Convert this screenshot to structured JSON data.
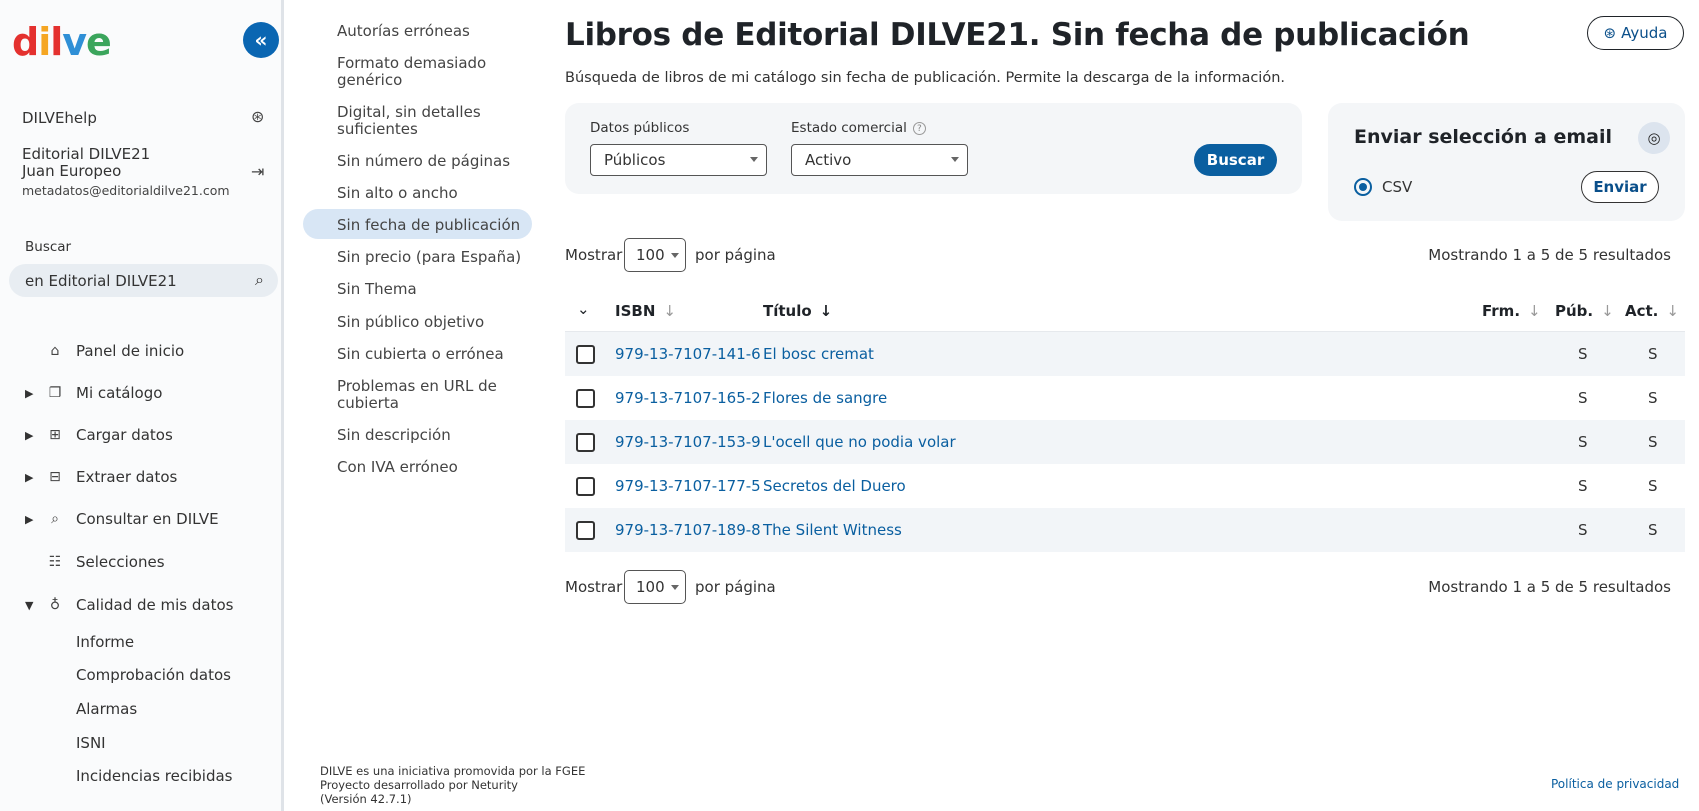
{
  "sidebar": {
    "logo": {
      "l1": "d",
      "l2": "i",
      "l3": "l",
      "l4": "v",
      "l5": "e"
    },
    "collapse_icon": "«",
    "help_label": "DILVEhelp",
    "user": {
      "company": "Editorial DILVE21",
      "name": "Juan Europeo",
      "email": "metadatos@editorialdilve21.com"
    },
    "search": {
      "label": "Buscar",
      "value": "en Editorial DILVE21"
    },
    "nav": [
      {
        "label": "Panel de inicio"
      },
      {
        "label": "Mi catálogo"
      },
      {
        "label": "Cargar datos"
      },
      {
        "label": "Extraer datos"
      },
      {
        "label": "Consultar en DILVE"
      },
      {
        "label": "Selecciones"
      },
      {
        "label": "Calidad de mis datos"
      }
    ],
    "sub": [
      {
        "label": "Informe"
      },
      {
        "label": "Comprobación datos"
      },
      {
        "label": "Alarmas"
      },
      {
        "label": "ISNI"
      },
      {
        "label": "Incidencias recibidas"
      }
    ]
  },
  "checks": [
    "Autorías erróneas",
    "Formato demasiado genérico",
    "Digital, sin detalles suficientes",
    "Sin número de páginas",
    "Sin alto o ancho",
    "Sin fecha de publicación",
    "Sin precio (para España)",
    "Sin Thema",
    "Sin público objetivo",
    "Sin cubierta o errónea",
    "Problemas en URL de cubierta",
    "Sin descripción",
    "Con IVA erróneo"
  ],
  "main": {
    "title": "Libros de Editorial DILVE21. Sin fecha de publicación",
    "description": "Búsqueda de libros de mi catálogo sin fecha de publicación. Permite la descarga de la información.",
    "help_button": "Ayuda",
    "filters": {
      "public_label": "Datos públicos",
      "public_value": "Públicos",
      "status_label": "Estado comercial",
      "status_value": "Activo",
      "search_button": "Buscar"
    },
    "email": {
      "title": "Enviar selección a email",
      "format": "CSV",
      "send_button": "Enviar"
    },
    "pager": {
      "show": "Mostrar",
      "per_page_value": "100",
      "per_page": "por página",
      "results": "Mostrando 1 a 5 de 5 resultados"
    },
    "table": {
      "headers": {
        "isbn": "ISBN",
        "title": "Título",
        "frm": "Frm.",
        "pub": "Púb.",
        "act": "Act."
      },
      "rows": [
        {
          "isbn": "979-13-7107-141-6",
          "title": "El bosc cremat",
          "pub": "S",
          "act": "S"
        },
        {
          "isbn": "979-13-7107-165-2",
          "title": "Flores de sangre",
          "pub": "S",
          "act": "S"
        },
        {
          "isbn": "979-13-7107-153-9",
          "title": "L'ocell que no podia volar",
          "pub": "S",
          "act": "S"
        },
        {
          "isbn": "979-13-7107-177-5",
          "title": "Secretos del Duero",
          "pub": "S",
          "act": "S"
        },
        {
          "isbn": "979-13-7107-189-8",
          "title": "The Silent Witness",
          "pub": "S",
          "act": "S"
        }
      ]
    }
  },
  "footer": {
    "line1": "DILVE es una iniciativa promovida por la FGEE",
    "line2": "Proyecto desarrollado por Neturity",
    "line3": "(Versión 42.7.1)",
    "privacy": "Política de privacidad"
  },
  "colors": {
    "accent": "#0a5fa0",
    "active_bg": "#d8e6f5",
    "card_bg": "#f4f6f8"
  }
}
